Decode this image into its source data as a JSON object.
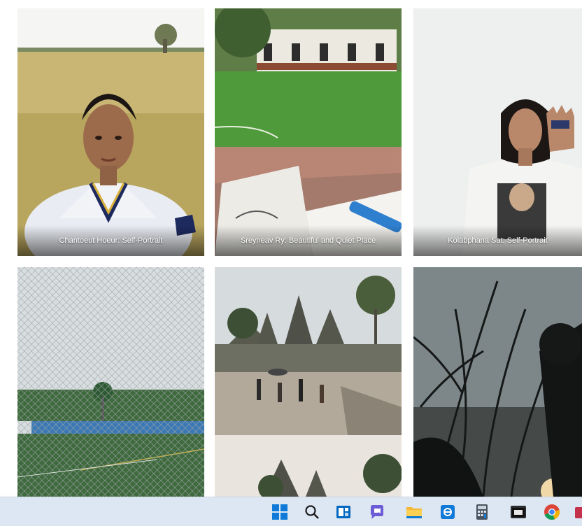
{
  "gallery": {
    "tiles": [
      {
        "caption": "Chantoeut Hoeur: Self-Portrait"
      },
      {
        "caption": "Sreyneav Ry: Beautiful and Quiet Place"
      },
      {
        "caption": "Kolabphana Sat: Self-Portrait"
      },
      {
        "caption": ""
      },
      {
        "caption": ""
      },
      {
        "caption": ""
      }
    ]
  },
  "taskbar": {
    "icons": [
      "windows-start-icon",
      "search-icon",
      "task-view-icon",
      "chat-icon",
      "file-explorer-icon",
      "store-icon",
      "calculator-icon",
      "terminal-icon",
      "chrome-icon"
    ]
  },
  "colors": {
    "taskbar_bg": "#dde6f3",
    "accent": "#0067c0"
  }
}
